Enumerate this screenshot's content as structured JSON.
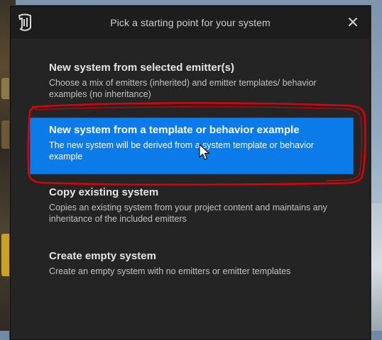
{
  "dialog": {
    "title": "Pick a starting point for your system",
    "close_icon": "close-icon",
    "logo_icon": "unreal-engine-logo-icon"
  },
  "options": [
    {
      "title": "New system from selected emitter(s)",
      "description": "Choose a mix of emitters (inherited) and emitter templates/ behavior examples (no inheritance)",
      "selected": false
    },
    {
      "title": "New system from a template or behavior example",
      "description": "The new system will be derived from a system template or behavior example",
      "selected": true
    },
    {
      "title": "Copy existing system",
      "description": "Copies an existing system from your project content and maintains any inheritance of the included emitters",
      "selected": false
    },
    {
      "title": "Create empty system",
      "description": "Create an empty system with no emitters or emitter templates",
      "selected": false
    }
  ],
  "colors": {
    "dialog_bg": "#242424",
    "titlebar_bg": "#1d1d1d",
    "selected_bg": "#0b7bea",
    "annotation": "#e0000a"
  }
}
